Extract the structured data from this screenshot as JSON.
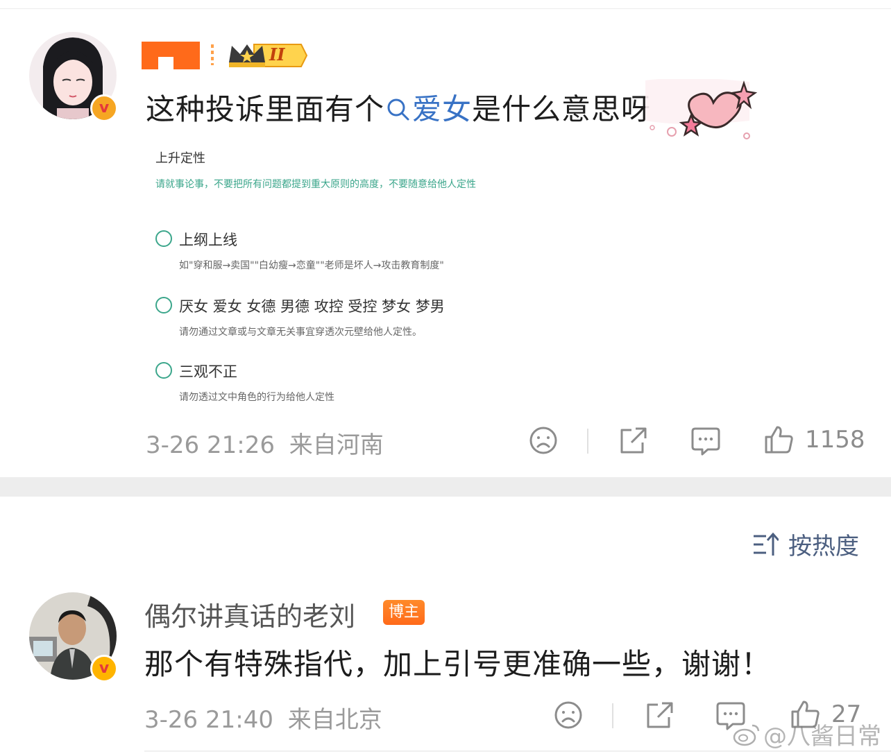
{
  "post": {
    "text_before": "这种投诉里面有个",
    "topic": "爱女",
    "text_after": "是什么意思呀",
    "vip_level": "II",
    "time": "3-26 21:26",
    "location": "来自河南",
    "like_count": "1158",
    "badge_v": "v",
    "screenshot": {
      "title": "上升定性",
      "hint": "请就事论事，不要把所有问题都提到重大原则的高度，不要随意给他人定性",
      "options": [
        {
          "label": "上纲上线",
          "sub": "如\"穿和服→卖国\"\"白幼瘦→恋童\"\"老师是坏人→攻击教育制度\""
        },
        {
          "label": "厌女 爱女 女德 男德 攻控 受控 梦女 梦男",
          "sub": "请勿通过文章或与文章无关事宜穿透次元壁给他人定性。"
        },
        {
          "label": "三观不正",
          "sub": "请勿透过文中角色的行为给他人定性"
        }
      ]
    }
  },
  "sort": {
    "label": "按热度"
  },
  "comment": {
    "author": "偶尔讲真话的老刘",
    "badge": "博主",
    "badge_v": "v",
    "text": "那个有特殊指代，加上引号更准确一些，谢谢！",
    "time": "3-26 21:40",
    "location": "来自北京",
    "like_count": "27"
  },
  "watermark": "@八酱日常",
  "colors": {
    "link": "#3872c5",
    "accent_green": "#3ba68b",
    "host_badge": "#ff7a1f"
  },
  "icons": [
    "search-icon",
    "sad-face-icon",
    "share-icon",
    "comment-icon",
    "like-icon",
    "sort-icon",
    "weibo-logo-icon"
  ]
}
